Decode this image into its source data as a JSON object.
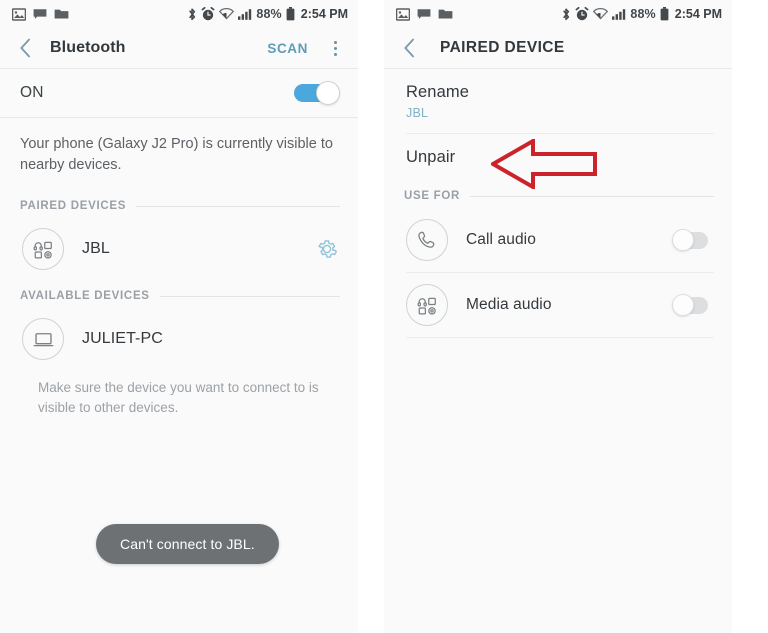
{
  "status_bar": {
    "notification_icons": [
      "image-icon",
      "message-icon",
      "folder-icon"
    ],
    "system_icons": [
      "bluetooth-icon",
      "alarm-icon",
      "wifi-icon",
      "signal-icon",
      "battery-icon"
    ],
    "battery_percent": "88%",
    "time": "2:54 PM"
  },
  "colors": {
    "accent_blue": "#4aa8dd",
    "link_teal": "#7fb3c6",
    "scan_teal": "#5f9cb5",
    "gear_teal": "#8fc3d6",
    "annotation_red": "#cc2229",
    "panel_bg": "#fafafa",
    "toast_bg": "#6e7174"
  },
  "left_screen": {
    "app_bar": {
      "back_icon": "chevron-left-icon",
      "title": "Bluetooth",
      "scan_label": "SCAN",
      "overflow_icon": "more-vertical-icon"
    },
    "power_row": {
      "label": "ON",
      "toggle_state": "on"
    },
    "visibility_text": "Your phone (Galaxy J2 Pro) is currently visible to nearby devices.",
    "paired_section": {
      "header": "PAIRED DEVICES",
      "devices": [
        {
          "name": "JBL",
          "icon": "bluetooth-audio-device-icon",
          "settings_icon": "gear-icon"
        }
      ]
    },
    "available_section": {
      "header": "AVAILABLE DEVICES",
      "devices": [
        {
          "name": "JULIET-PC",
          "icon": "laptop-icon"
        }
      ],
      "hint": "Make sure the device you want to connect to is visible to other devices."
    },
    "toast": {
      "message": "Can't connect to JBL."
    }
  },
  "right_screen": {
    "app_bar": {
      "back_icon": "chevron-left-icon",
      "title": "PAIRED DEVICE"
    },
    "rows": [
      {
        "title": "Rename",
        "subtitle": "JBL"
      },
      {
        "title": "Unpair",
        "subtitle": ""
      }
    ],
    "use_for_section": {
      "header": "USE FOR",
      "items": [
        {
          "label": "Call audio",
          "icon": "phone-handset-icon",
          "toggle_state": "off"
        },
        {
          "label": "Media audio",
          "icon": "bluetooth-audio-device-icon",
          "toggle_state": "off"
        }
      ]
    }
  },
  "annotation": {
    "shape": "left-arrow",
    "color": "#cc2229"
  }
}
